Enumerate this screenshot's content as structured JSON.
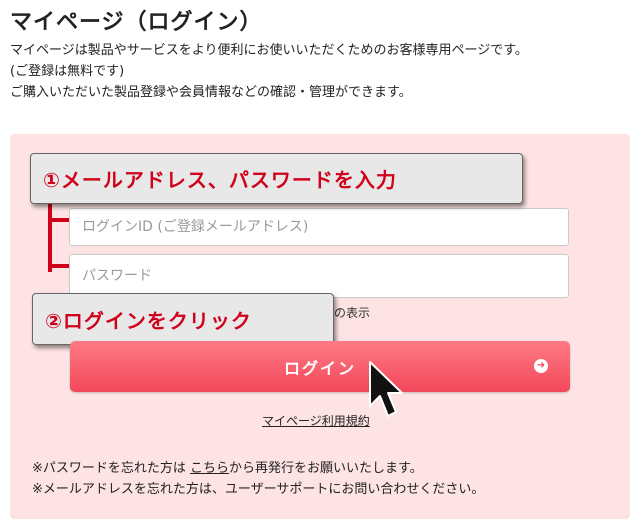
{
  "header": {
    "title": "マイページ（ログイン）",
    "intro_lines": [
      "マイページは製品やサービスをより便利にお使いいただくためのお客様専用ページです。",
      "(ご登録は無料です)",
      "ご購入いただいた製品登録や会員情報などの確認・管理ができます。"
    ]
  },
  "form": {
    "login_id_placeholder": "ログインID (ご登録メールアドレス)",
    "password_placeholder": "パスワード",
    "show_password_label": "ドの表示",
    "login_button_label": "ログイン",
    "terms_link": "マイページ利用規約"
  },
  "annotations": {
    "step1": "①メールアドレス、パスワードを入力",
    "step2": "②ログインをクリック"
  },
  "notes": {
    "forgot_password_prefix": "※パスワードを忘れた方は ",
    "forgot_password_link": "こちら",
    "forgot_password_suffix": "から再発行をお願いいたします。",
    "forgot_email": "※メールアドレスを忘れた方は、ユーザーサポートにお問い合わせください。"
  },
  "colors": {
    "accent_red": "#d0021b",
    "button_pink": "#f2475a",
    "panel_bg": "#fde3e3"
  },
  "icons": {
    "button_arrow": "arrow-circle-right-icon",
    "pointer": "mouse-cursor-icon"
  }
}
